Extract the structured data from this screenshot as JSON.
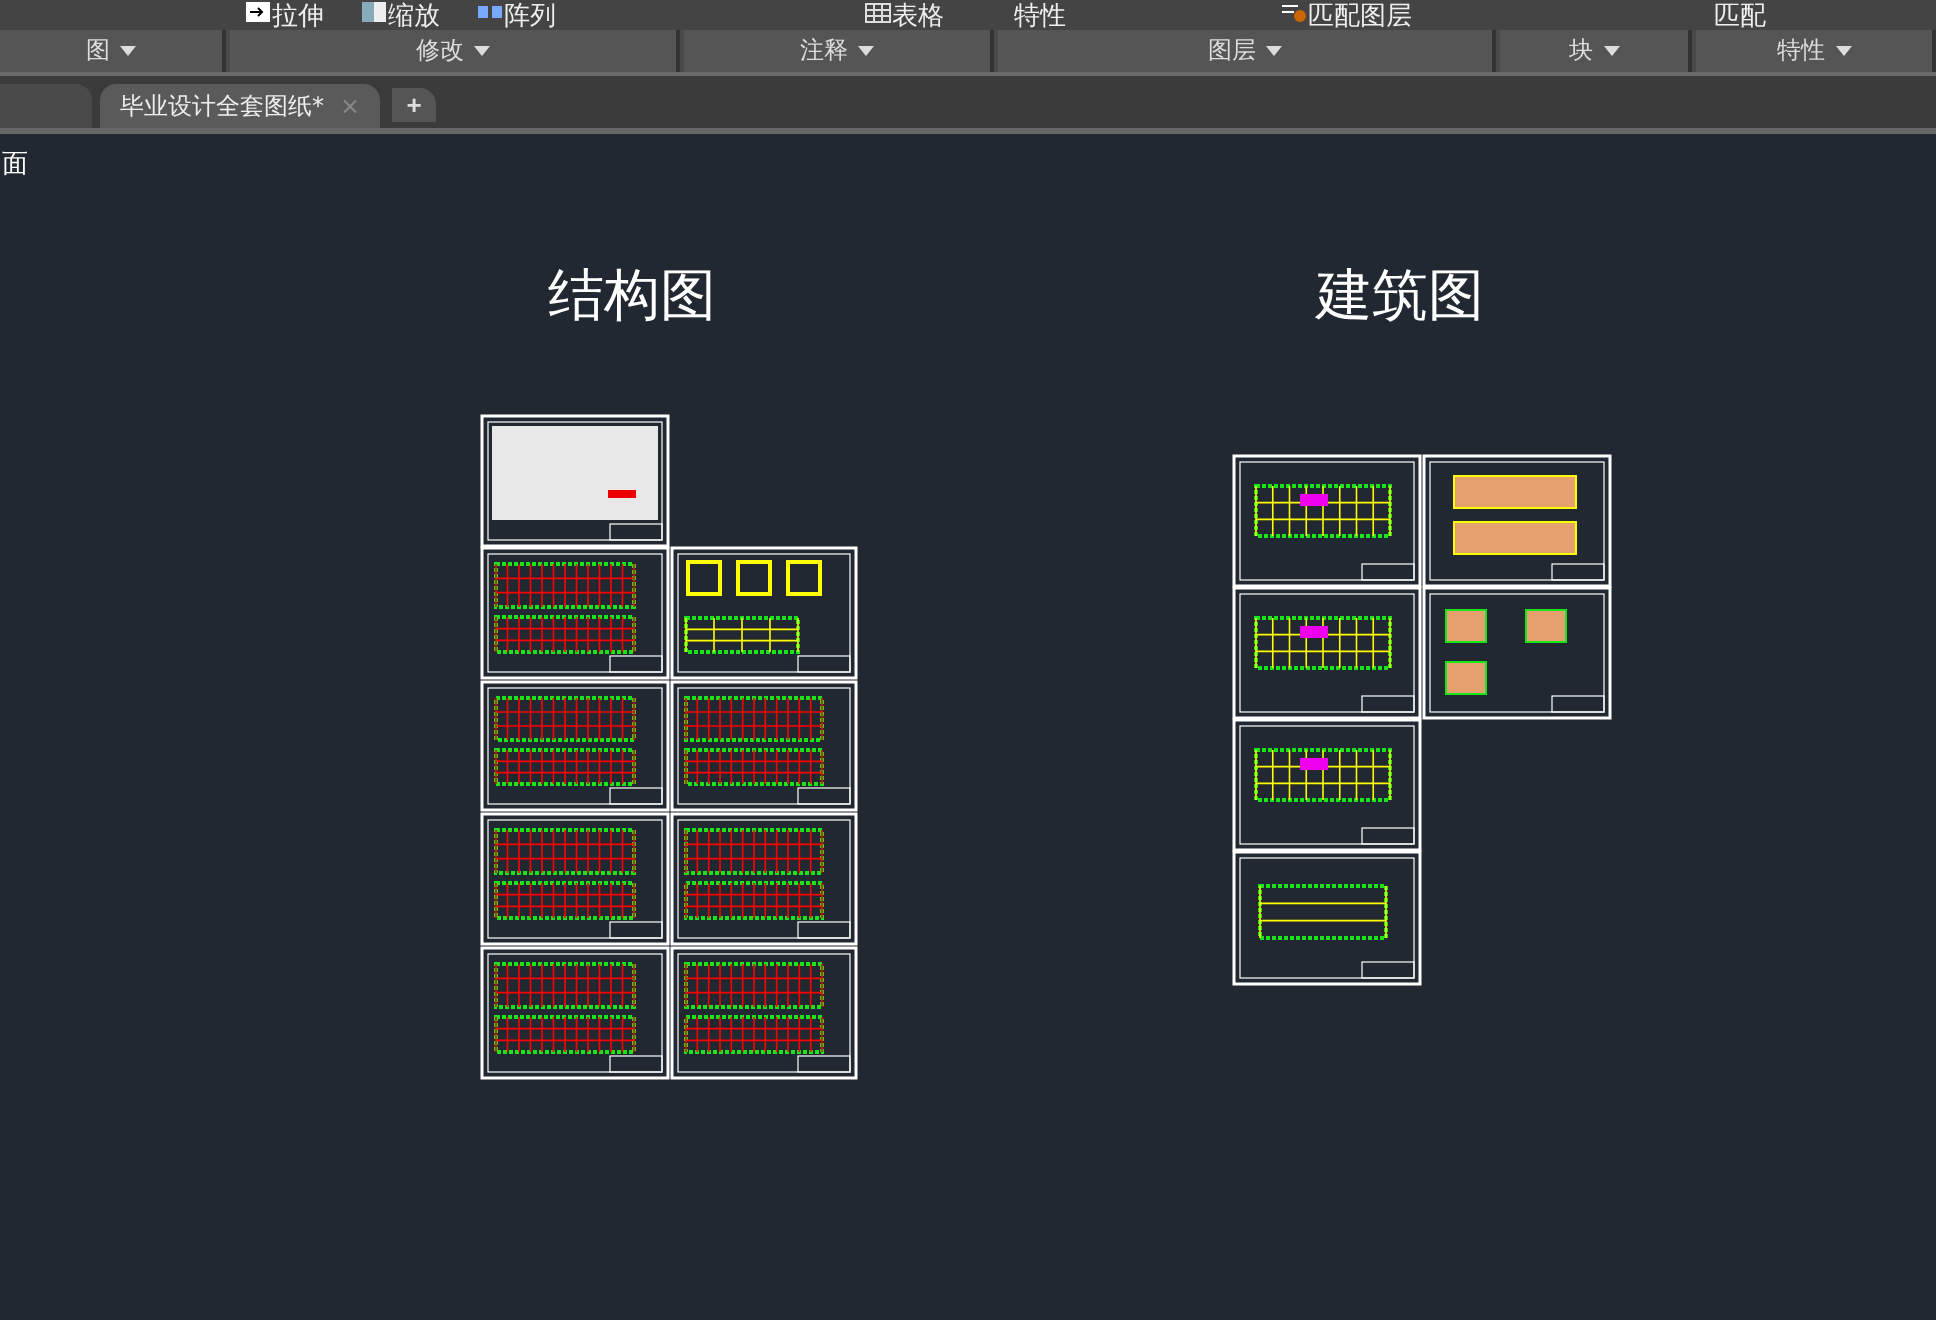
{
  "ribbon": {
    "tools": [
      {
        "label": "拉伸",
        "kind": "stretch"
      },
      {
        "label": "缩放",
        "kind": "scale"
      },
      {
        "label": "阵列",
        "kind": "array"
      },
      {
        "label": "表格",
        "kind": "table"
      },
      {
        "label": "特性",
        "kind": "plain"
      },
      {
        "label": "匹配图层",
        "kind": "match"
      },
      {
        "label": "匹配",
        "kind": "plain"
      }
    ],
    "panels": [
      {
        "label": "图"
      },
      {
        "label": "修改"
      },
      {
        "label": "注释"
      },
      {
        "label": "图层"
      },
      {
        "label": "块"
      },
      {
        "label": "特性"
      }
    ]
  },
  "tabs": [
    {
      "label": "毕业设计全套图纸*",
      "selected": true,
      "close": "×"
    }
  ],
  "new_tab": "+",
  "canvas": {
    "corner_text": "面",
    "groups": [
      {
        "title": "结构图"
      },
      {
        "title": "建筑图"
      }
    ]
  }
}
